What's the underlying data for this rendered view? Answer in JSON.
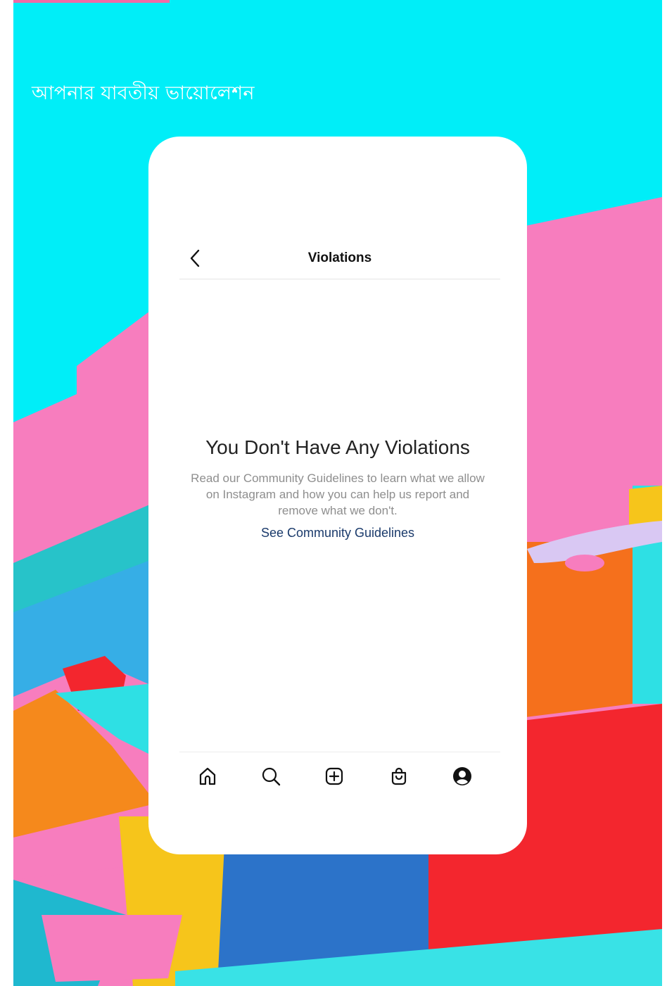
{
  "page": {
    "heading": "আপনার যাবতীয় ভায়োলেশন"
  },
  "colors": {
    "background_cyan": "#00eef8",
    "accent_pink": "#f06aa6",
    "wall_pink": "#f77dbe",
    "red": "#f3262e",
    "orange": "#f5701c",
    "yellow": "#f6c51b",
    "blue": "#2c73c9",
    "teal": "#27c3c9",
    "link_blue": "#1a3a6b"
  },
  "phone": {
    "header": {
      "back_icon": "chevron-left-icon",
      "title": "Violations"
    },
    "empty_state": {
      "title": "You Don't Have Any Violations",
      "body": "Read our Community Guidelines to learn what we allow on Instagram and how you can help us report and remove what we don't.",
      "link": "See Community Guidelines"
    },
    "tab_bar": {
      "tabs": [
        {
          "icon": "home-icon"
        },
        {
          "icon": "search-icon"
        },
        {
          "icon": "new-post-icon"
        },
        {
          "icon": "shop-icon"
        },
        {
          "icon": "profile-icon"
        }
      ]
    }
  }
}
